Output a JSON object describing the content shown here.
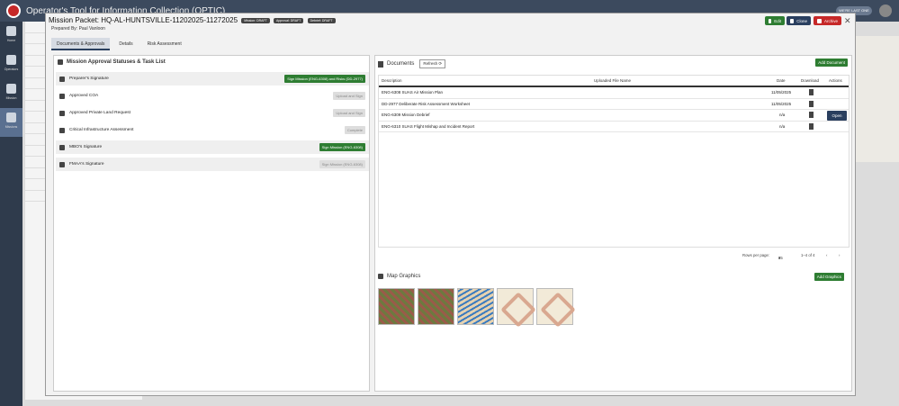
{
  "app": {
    "title": "Operator's Tool for Information Collection (OPTIC)",
    "user_pill": "WE'RE LAST ONE"
  },
  "nav": [
    "Home",
    "Operators",
    "Mission",
    "Missions"
  ],
  "modal": {
    "title": "Mission Packet: HQ-AL-HUNTSVILLE-11202025-11272025",
    "badges": [
      "Mission: DRAFT",
      "Approval: DRAFT",
      "Debrief: DRAFT"
    ],
    "prepared_by": "Prepared By: Paul Vanloon",
    "buttons": {
      "edit": "Edit",
      "clone": "Clone",
      "archive": "Archive"
    },
    "tabs": [
      "Documents & Approvals",
      "Details",
      "Risk Assessment"
    ]
  },
  "approvals": {
    "title": "Mission Approval Statuses & Task List",
    "rows": [
      {
        "label": "Preparer's Signature",
        "action": "Sign Mission (ENG-6308) and Risks (DD-2977)",
        "style": "primary"
      },
      {
        "label": "Approved COA",
        "action": "Upload and Sign",
        "style": "muted"
      },
      {
        "label": "Approved Private Land Request",
        "action": "Upload and Sign",
        "style": "muted"
      },
      {
        "label": "Critical Infrastructure Assessment",
        "action": "Complete",
        "style": "muted"
      },
      {
        "label": "MBO's Signature",
        "action": "Sign Mission (ENG-6308)",
        "style": "primary"
      },
      {
        "label": "FMAA's Signature",
        "action": "Sign Mission (ENG-6308)",
        "style": "muted"
      }
    ]
  },
  "documents": {
    "title": "Documents",
    "refresh": "Refresh",
    "add": "Add Document",
    "columns": [
      "Description",
      "Uploaded File Name",
      "Date",
      "Download",
      "Actions"
    ],
    "rows": [
      {
        "description": "ENG-6308 SUAS Air Mission Plan",
        "file": "",
        "date": "11/05/2025",
        "action": ""
      },
      {
        "description": "DD-2977 Deliberate Risk Assessment Worksheet",
        "file": "",
        "date": "11/05/2025",
        "action": ""
      },
      {
        "description": "ENG-6309 Mission Debrief",
        "file": "",
        "date": "n/a",
        "action": "Open"
      },
      {
        "description": "ENG-6310 SUAS Flight Mishap and Incident Report",
        "file": "",
        "date": "n/a",
        "action": ""
      }
    ],
    "pager": {
      "rows_label": "Rows per page:",
      "rows_value": "25",
      "range": "1–4 of 4"
    }
  },
  "graphics": {
    "title": "Map Graphics",
    "add": "Add Graphics",
    "count": 5
  }
}
